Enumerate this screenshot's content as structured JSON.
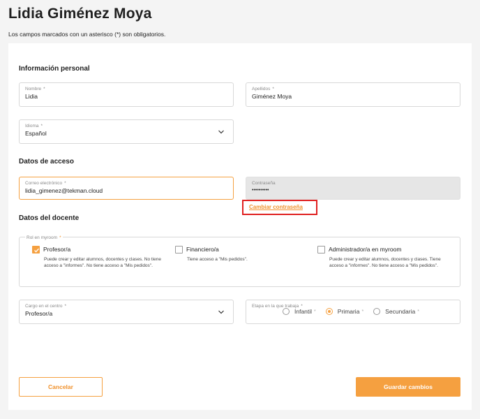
{
  "header": {
    "title": "Lidia Giménez Moya",
    "subtitle": "Los campos marcados con un asterisco (*) son obligatorios."
  },
  "personal": {
    "heading": "Información personal",
    "nombre": {
      "label": "Nombre",
      "required": "*",
      "value": "Lidia"
    },
    "apellidos": {
      "label": "Apellidos",
      "required": "*",
      "value": "Giménez Moya"
    },
    "idioma": {
      "label": "Idioma",
      "required": "*",
      "value": "Español",
      "icon": "chevron-down-icon"
    }
  },
  "access": {
    "heading": "Datos de acceso",
    "email": {
      "label": "Correo electrónico",
      "required": "*",
      "value": "lidia_gimenez@tekman.cloud"
    },
    "password": {
      "label": "Contraseña",
      "value": "••••••••••"
    },
    "change_password_link": "Cambiar contraseña"
  },
  "teacher": {
    "heading": "Datos del docente",
    "role": {
      "label": "Rol en myroom",
      "required": "*",
      "options": [
        {
          "name": "Profesor/a",
          "checked": true,
          "description": "Puede crear y editar alumnos, docentes y clases. No tiene acceso a \"informes\". No tiene acceso a \"Mis pedidos\"."
        },
        {
          "name": "Financiero/a",
          "checked": false,
          "description": "Tiene acceso a \"Mis pedidos\"."
        },
        {
          "name": "Administrador/a en myroom",
          "checked": false,
          "description": "Puede crear y editar alumnos, docentes y clases. Tiene acceso a \"informes\". No tiene acceso a \"Mis pedidos\"."
        }
      ]
    },
    "cargo": {
      "label": "Cargo en el centro",
      "required": "*",
      "value": "Profesor/a",
      "icon": "chevron-down-icon"
    },
    "etapa": {
      "label": "Etapa en la que trabaja",
      "required": "*",
      "options": [
        {
          "name": "Infantil",
          "selected": false,
          "required": "*"
        },
        {
          "name": "Primaria",
          "selected": true,
          "required": "*"
        },
        {
          "name": "Secundaria",
          "selected": false,
          "required": "*"
        }
      ]
    }
  },
  "actions": {
    "cancel": "Cancelar",
    "save": "Guardar cambios"
  },
  "colors": {
    "accent": "#f5a040",
    "highlight": "#e02020"
  }
}
